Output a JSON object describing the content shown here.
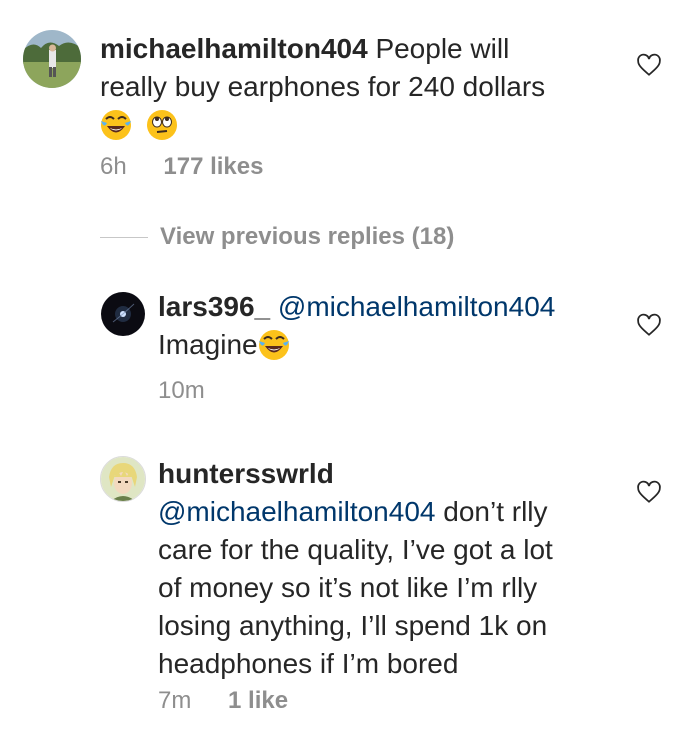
{
  "comment": {
    "username": "michaelhamilton404",
    "text_line1": "People will",
    "text_line2": "really buy earphones for 240 dollars",
    "emojis": [
      "laughing-crying-emoji",
      "eye-roll-emoji"
    ],
    "time": "6h",
    "likes": "177 likes"
  },
  "view_previous": "View previous replies (18)",
  "replies": [
    {
      "username": "lars396_",
      "mention": "@michaelhamilton404",
      "text": "Imagine",
      "emoji": "laughing-crying-emoji",
      "time": "10m"
    },
    {
      "username": "huntersswrld",
      "mention": "@michaelhamilton404",
      "text_line1": "don’t rlly",
      "text_line2": "care for the quality, I’ve got a lot",
      "text_line3": "of money so it’s not like I’m rlly",
      "text_line4": "losing anything, I’ll spend 1k on",
      "text_line5": "headphones if I’m bored",
      "time": "7m",
      "likes": "1 like"
    }
  ],
  "icons": {
    "like": "heart-outline-icon"
  },
  "colors": {
    "text": "#262626",
    "muted": "#8e8e8e",
    "mention": "#00376b"
  }
}
